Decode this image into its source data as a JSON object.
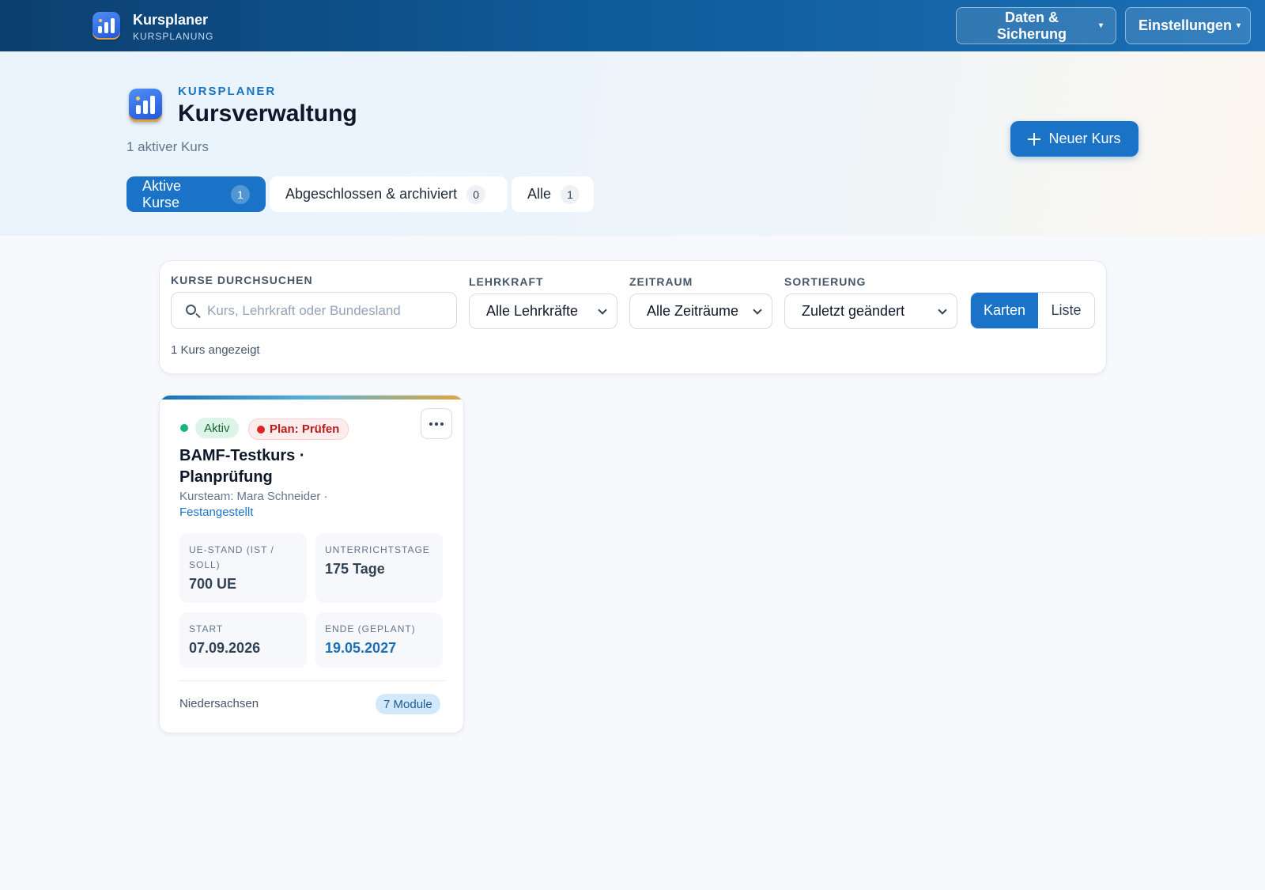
{
  "app": {
    "name": "Kursplaner",
    "subtitle": "KURSPLANUNG"
  },
  "topnav": {
    "data_backup": "Daten & Sicherung",
    "settings": "Einstellungen",
    "caret": "▾"
  },
  "hero": {
    "eyebrow": "KURSPLANER",
    "title": "Kursverwaltung",
    "subtitle": "1 aktiver Kurs",
    "new_course": "Neuer Kurs"
  },
  "tabs": [
    {
      "label": "Aktive Kurse",
      "count": "1",
      "active": true
    },
    {
      "label": "Abgeschlossen & archiviert",
      "count": "0",
      "active": false
    },
    {
      "label": "Alle",
      "count": "1",
      "active": false
    }
  ],
  "filters": {
    "search_label": "KURSE DURCHSUCHEN",
    "search_placeholder": "Kurs, Lehrkraft oder Bundesland",
    "teacher_label": "LEHRKRAFT",
    "teacher_value": "Alle Lehrkräfte",
    "period_label": "ZEITRAUM",
    "period_value": "Alle Zeiträume",
    "sort_label": "SORTIERUNG",
    "sort_value": "Zuletzt geändert",
    "view_cards": "Karten",
    "view_list": "Liste",
    "result_count": "1 Kurs angezeigt"
  },
  "course": {
    "status": "Aktiv",
    "plan_status": "Plan: Prüfen",
    "title": "BAMF-Testkurs · Planprüfung",
    "team": "Kursteam: Mara Schneider ·",
    "role": "Festangestellt",
    "stats": {
      "ue_label": "UE-STAND (IST / SOLL)",
      "ue_value": "700 UE",
      "days_label": "UNTERRICHTSTAGE",
      "days_value": "175 Tage",
      "start_label": "START",
      "start_value": "07.09.2026",
      "end_label": "ENDE (GEPLANT)",
      "end_value": "19.05.2027"
    },
    "region": "Niedersachsen",
    "modules": "7 Module"
  },
  "colors": {
    "accent": "#1a73c6",
    "active_green": "#16b67a",
    "plan_red": "#dc2626"
  }
}
